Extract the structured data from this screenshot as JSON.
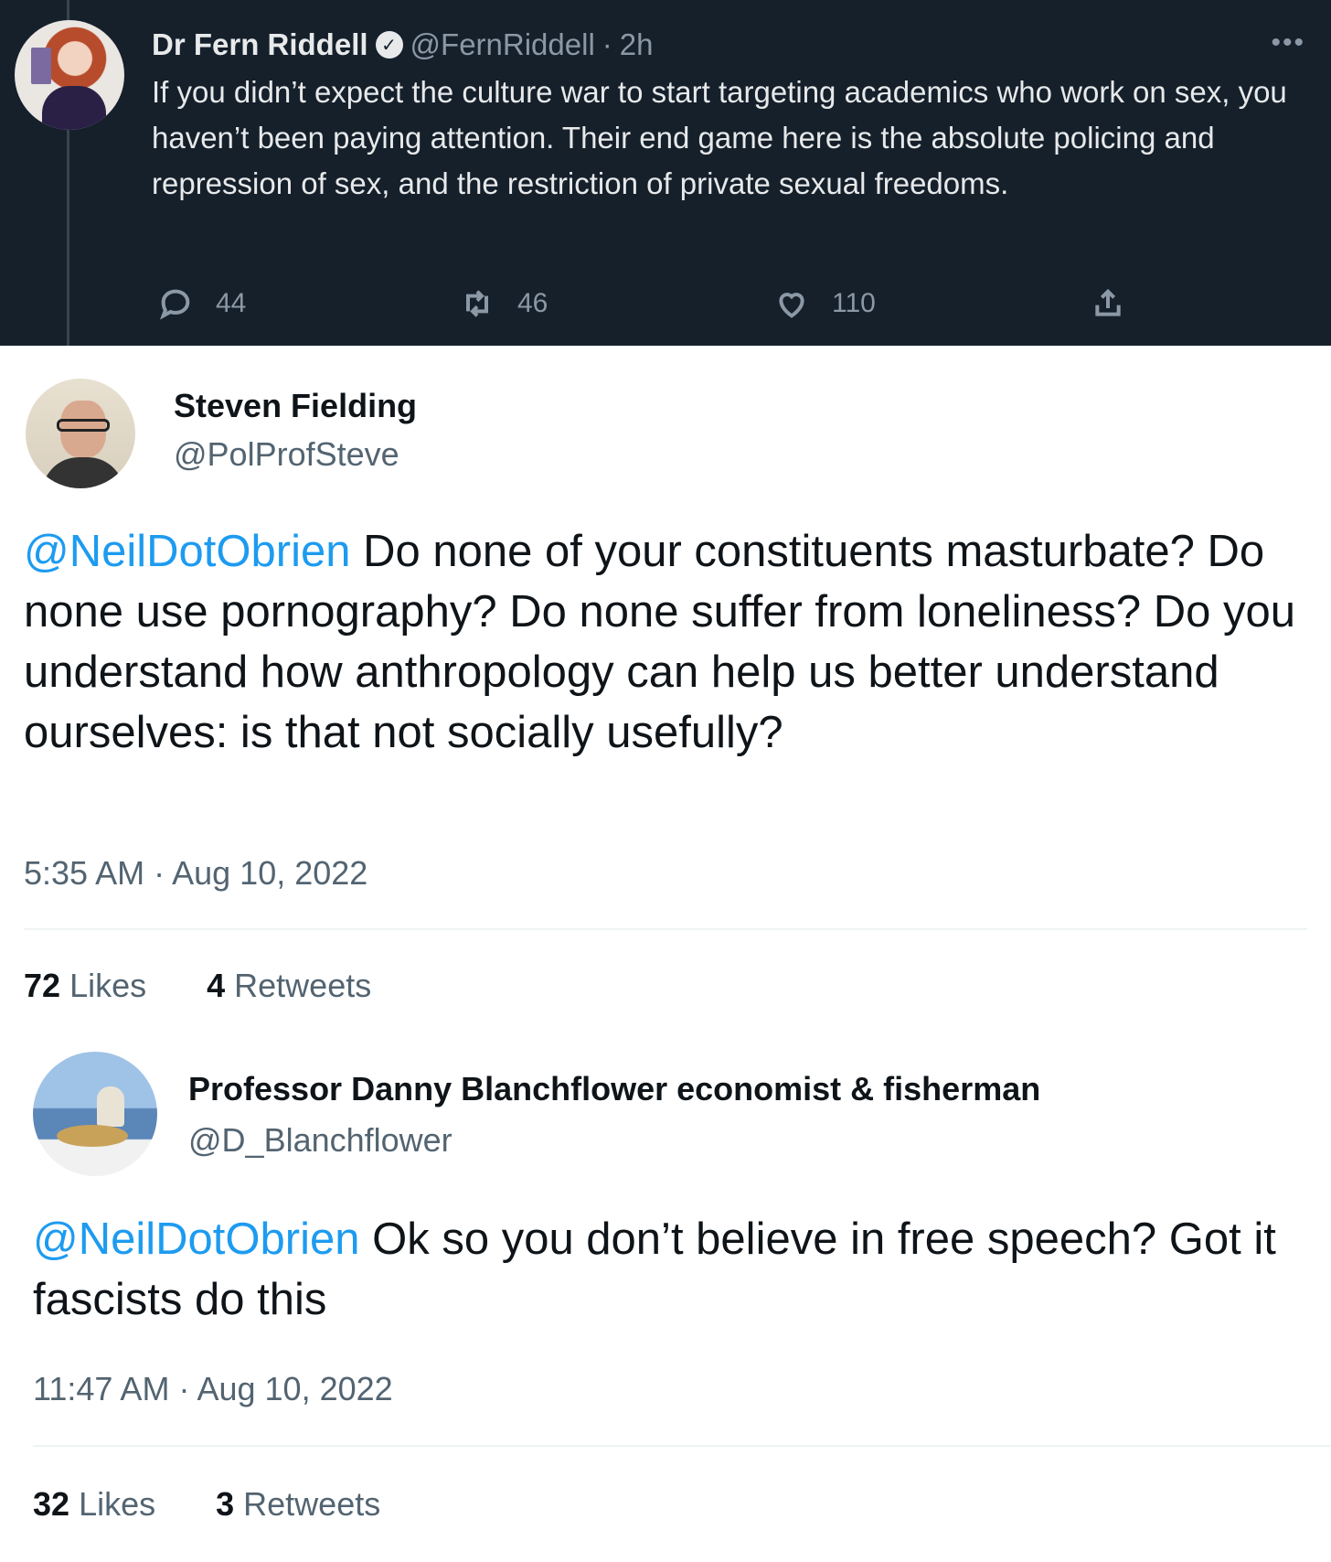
{
  "quoted_tweet": {
    "author_name": "Dr Fern Riddell",
    "verified": true,
    "handle": "@FernRiddell",
    "separator": "·",
    "time_ago": "2h",
    "more_icon": "more-horizontal-icon",
    "text": "If you didn’t expect the culture war to start targeting academics who work on sex, you haven’t been paying attention. Their end game here is the absolute policing and repression of sex, and the restriction of private sexual freedoms.",
    "actions": {
      "replies": "44",
      "retweets": "46",
      "likes": "110"
    },
    "colors": {
      "background": "#15202b",
      "text": "#e7e9ea",
      "muted": "#8b98a5"
    }
  },
  "reply_1": {
    "author_name": "Steven Fielding",
    "handle": "@PolProfSteve",
    "mention": "@NeilDotObrien",
    "text": " Do none of your constituents masturbate? Do none use pornography? Do none suffer from loneliness? Do you understand how anthropology can help us better understand ourselves: is that not socially usefully?",
    "time": "5:35 AM",
    "separator": "·",
    "date": "Aug 10, 2022",
    "likes_count": "72",
    "likes_label": "Likes",
    "retweets_count": "4",
    "retweets_label": "Retweets"
  },
  "reply_2": {
    "author_name": "Professor Danny Blanchflower economist & fisherman",
    "handle": "@D_Blanchflower",
    "mention": "@NeilDotObrien",
    "text": " Ok so you don’t believe in free speech? Got it fascists do this",
    "time": "11:47 AM",
    "separator": "·",
    "date": "Aug 10, 2022",
    "likes_count": "32",
    "likes_label": "Likes",
    "retweets_count": "3",
    "retweets_label": "Retweets"
  },
  "colors": {
    "mention": "#1d9bf0",
    "primary_text": "#0f1419",
    "secondary_text": "#536471"
  }
}
